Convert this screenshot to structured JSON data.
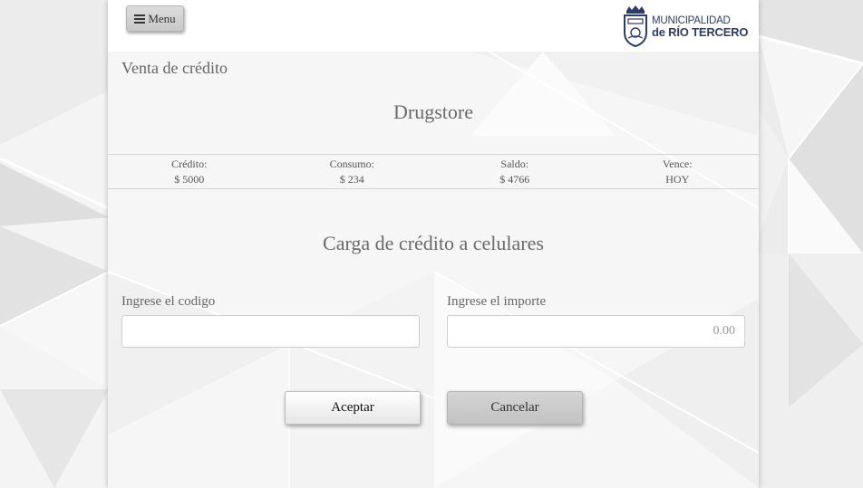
{
  "header": {
    "menu_label": "Menu",
    "logo_line1": "MUNICIPALIDAD",
    "logo_line2": "de RÍO TERCERO"
  },
  "page": {
    "section_title": "Venta de crédito",
    "store_name": "Drugstore"
  },
  "stats": [
    {
      "label": "Crédito:",
      "value": "$ 5000"
    },
    {
      "label": "Consumo:",
      "value": "$ 234"
    },
    {
      "label": "Saldo:",
      "value": "$ 4766"
    },
    {
      "label": "Vence:",
      "value": "HOY"
    }
  ],
  "form": {
    "title": "Carga de crédito a celulares",
    "code_label": "Ingrese el codigo",
    "code_value": "",
    "amount_label": "Ingrese el importe",
    "amount_placeholder": "0.00",
    "accept_label": "Aceptar",
    "cancel_label": "Cancelar"
  },
  "colors": {
    "brand": "#2d3a73",
    "background": "#ececec"
  },
  "icons": {
    "menu": "hamburger-icon",
    "logo": "municipal-shield-icon"
  }
}
